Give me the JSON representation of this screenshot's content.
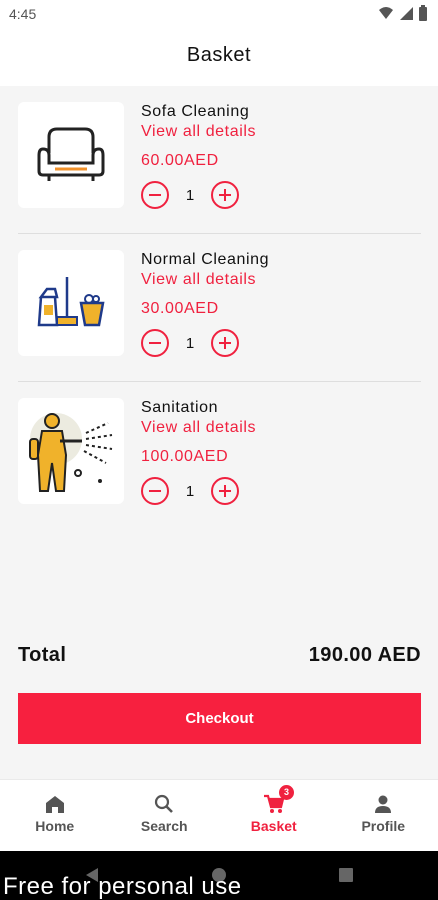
{
  "status_bar": {
    "time": "4:45",
    "icons": [
      "wifi-icon",
      "signal-icon",
      "battery-icon"
    ]
  },
  "app_bar": {
    "title": "Basket"
  },
  "items": [
    {
      "name": "Sofa Cleaning",
      "details_link": "View all details",
      "price": "60.00AED",
      "quantity": "1",
      "icon": "sofa-icon"
    },
    {
      "name": "Normal Cleaning",
      "details_link": "View all details",
      "price": "30.00AED",
      "quantity": "1",
      "icon": "cleaning-supplies-icon"
    },
    {
      "name": "Sanitation",
      "details_link": "View all details",
      "price": "100.00AED",
      "quantity": "1",
      "icon": "sanitation-worker-icon"
    }
  ],
  "total": {
    "label": "Total",
    "value": "190.00 AED"
  },
  "checkout": {
    "label": "Checkout"
  },
  "bottom_nav": {
    "items": [
      {
        "label": "Home",
        "icon": "home-icon",
        "active": false
      },
      {
        "label": "Search",
        "icon": "search-icon",
        "active": false
      },
      {
        "label": "Basket",
        "icon": "cart-icon",
        "active": true,
        "badge": "3"
      },
      {
        "label": "Profile",
        "icon": "person-icon",
        "active": false
      }
    ]
  },
  "watermark": "Free for personal use",
  "colors": {
    "accent": "#f0213f",
    "background": "#f5f5f5",
    "surface": "#ffffff"
  }
}
